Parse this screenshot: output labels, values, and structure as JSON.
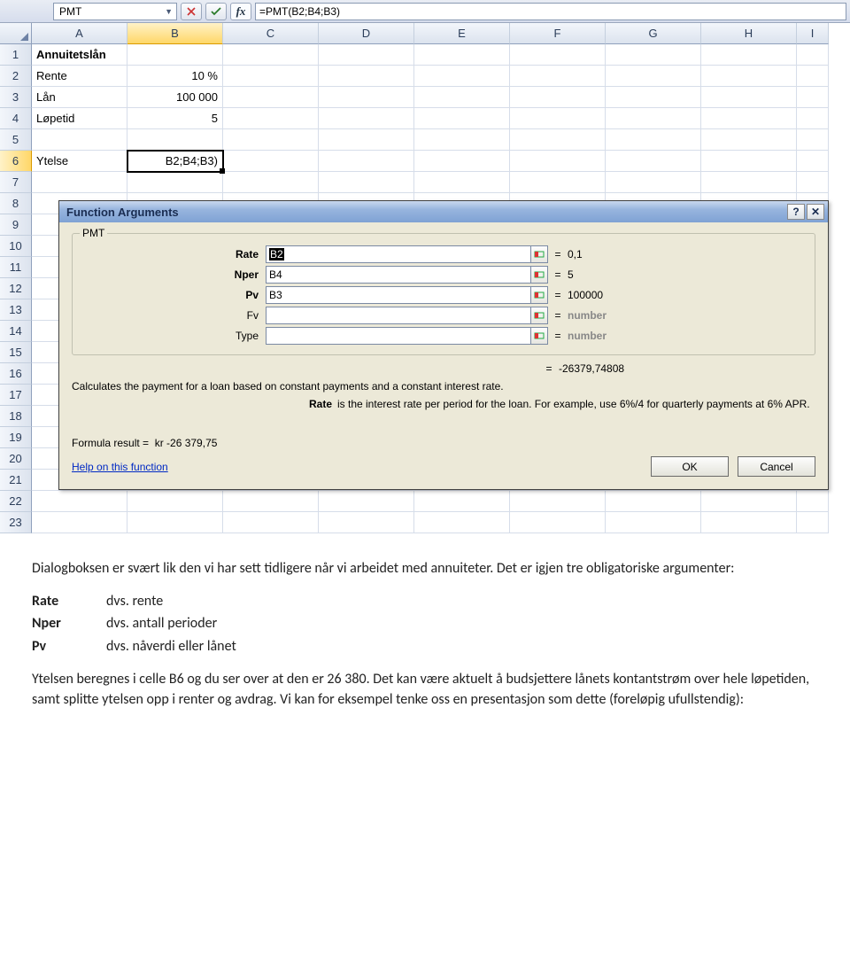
{
  "formula_bar": {
    "name_box": "PMT",
    "formula": "=PMT(B2;B4;B3)"
  },
  "columns": [
    "A",
    "B",
    "C",
    "D",
    "E",
    "F",
    "G",
    "H",
    "I"
  ],
  "row_numbers": [
    "1",
    "2",
    "3",
    "4",
    "5",
    "6",
    "7",
    "8",
    "9",
    "10",
    "11",
    "12",
    "13",
    "14",
    "15",
    "16",
    "17",
    "18",
    "19",
    "20",
    "21",
    "22",
    "23"
  ],
  "cells": {
    "A1": "Annuitetslån",
    "A2": "Rente",
    "B2": "10 %",
    "A3": "Lån",
    "B3": "100 000",
    "A4": "Løpetid",
    "B4": "5",
    "A6": "Ytelse",
    "B6": "B2;B4;B3)"
  },
  "dialog": {
    "title": "Function Arguments",
    "help_btn": "?",
    "close_btn": "✕",
    "legend": "PMT",
    "args": [
      {
        "label": "Rate",
        "bold": true,
        "value": "B2",
        "sel": true,
        "result": "0,1",
        "ph": false
      },
      {
        "label": "Nper",
        "bold": true,
        "value": "B4",
        "sel": false,
        "result": "5",
        "ph": false
      },
      {
        "label": "Pv",
        "bold": true,
        "value": "B3",
        "sel": false,
        "result": "100000",
        "ph": false
      },
      {
        "label": "Fv",
        "bold": false,
        "value": "",
        "sel": false,
        "result": "number",
        "ph": true
      },
      {
        "label": "Type",
        "bold": false,
        "value": "",
        "sel": false,
        "result": "number",
        "ph": true
      }
    ],
    "calc_result": "-26379,74808",
    "desc1": "Calculates the payment for a loan based on constant payments and a constant interest rate.",
    "desc2_label": "Rate",
    "desc2_text": "is the interest rate per period for the loan. For example, use 6%/4 for quarterly payments at 6% APR.",
    "formula_result_label": "Formula result =",
    "formula_result_value": "kr -26 379,75",
    "help_link": "Help on this function",
    "ok": "OK",
    "cancel": "Cancel"
  },
  "doc": {
    "p1": "Dialogboksen er svært lik den vi har sett tidligere når vi arbeidet med annuiteter. Det er igjen tre obligatoriske argumenter:",
    "defs": [
      {
        "k": "Rate",
        "v": "dvs. rente"
      },
      {
        "k": "Nper",
        "v": "dvs. antall perioder"
      },
      {
        "k": "Pv",
        "v": "dvs. nåverdi eller lånet"
      }
    ],
    "p2": "Ytelsen beregnes i celle B6 og du ser over at den er 26 380. Det kan være aktuelt å budsjettere lånets kontantstrøm over hele løpetiden, samt splitte ytelsen opp i renter og avdrag. Vi kan for eksempel tenke oss en presentasjon som dette (foreløpig ufullstendig):"
  }
}
